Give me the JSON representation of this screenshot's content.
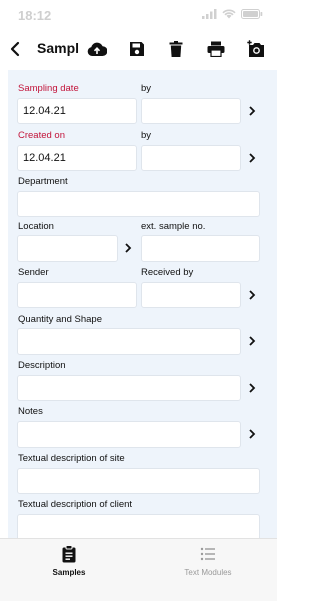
{
  "status": {
    "time": "18:12"
  },
  "toolbar": {
    "title": "Samples"
  },
  "form": {
    "sampling_date_label": "Sampling date",
    "sampling_date_value": "12.04.21",
    "sampling_by_label": "by",
    "sampling_by_value": "",
    "created_on_label": "Created on",
    "created_on_value": "12.04.21",
    "created_by_label": "by",
    "created_by_value": "",
    "department_label": "Department",
    "department_value": "",
    "location_label": "Location",
    "location_value": "",
    "ext_sample_label": "ext. sample no.",
    "ext_sample_value": "",
    "sender_label": "Sender",
    "sender_value": "",
    "received_by_label": "Received by",
    "received_by_value": "",
    "quantity_label": "Quantity and Shape",
    "quantity_value": "",
    "description_label": "Description",
    "description_value": "",
    "notes_label": "Notes",
    "notes_value": "",
    "site_desc_label": "Textual description of site",
    "site_desc_value": "",
    "client_desc_label": "Textual description of client",
    "client_desc_value": ""
  },
  "tabs": [
    {
      "label": "Samples",
      "icon": "clipboard-icon",
      "active": true
    },
    {
      "label": "Text Modules",
      "icon": "list-icon",
      "active": false
    }
  ]
}
